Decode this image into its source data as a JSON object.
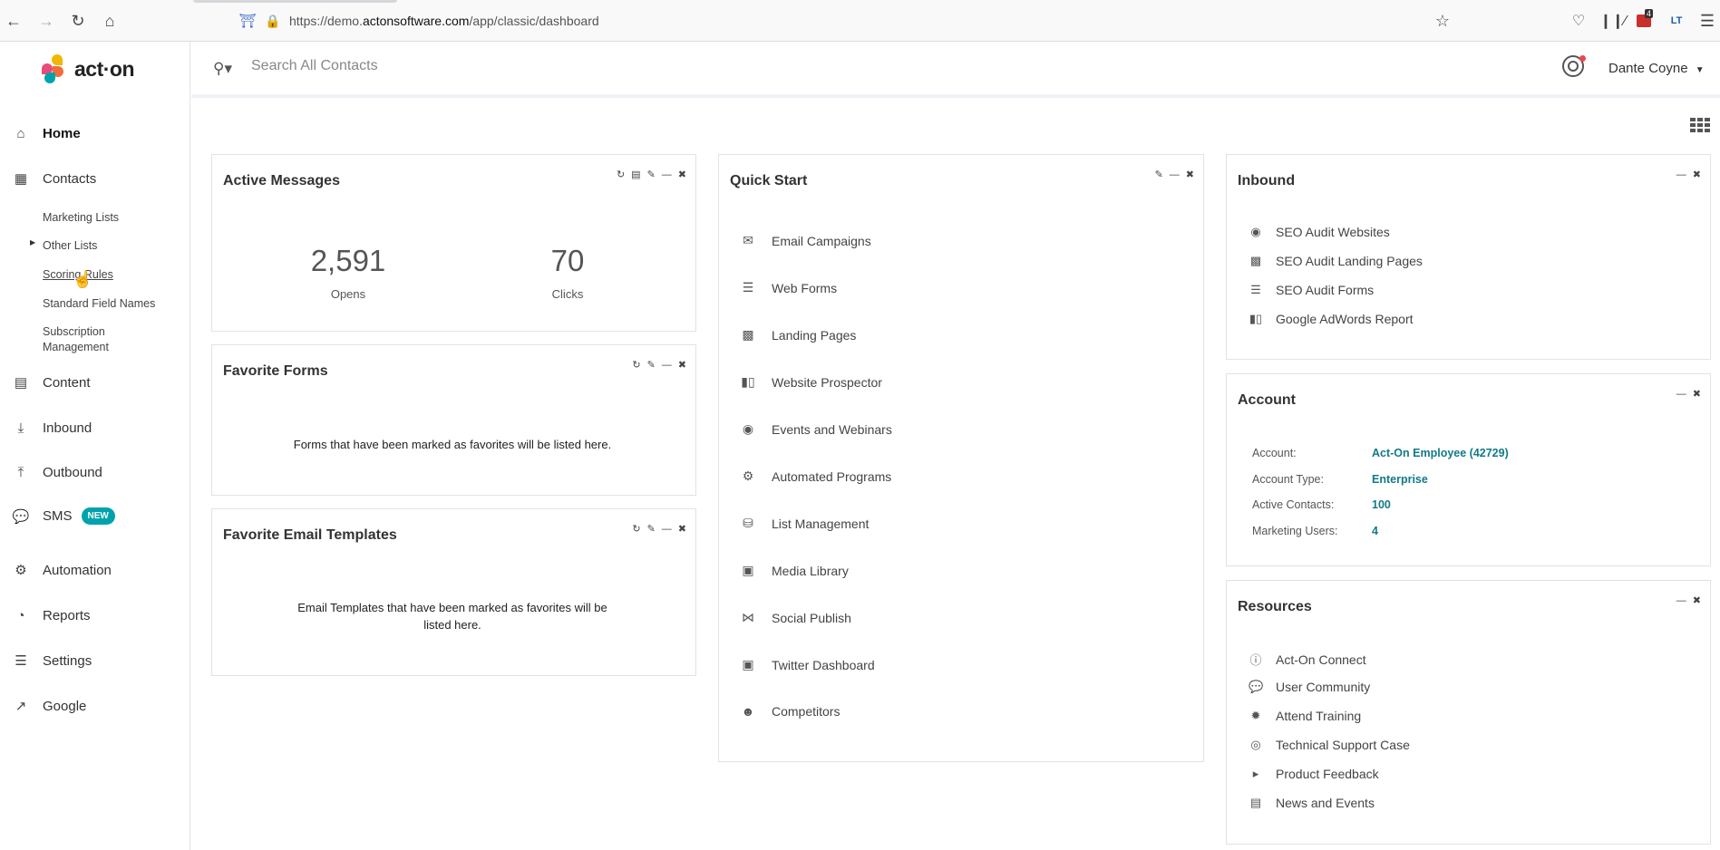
{
  "browser": {
    "url_prefix": "https://demo.",
    "url_host": "actonsoftware.com",
    "url_path": "/app/classic/dashboard",
    "toolbar_badge": "4"
  },
  "logo": {
    "text": "act·on"
  },
  "sidebar": {
    "items": [
      {
        "label": "Home",
        "icon": "home-icon"
      },
      {
        "label": "Contacts",
        "icon": "contacts-icon"
      },
      {
        "label": "Content",
        "icon": "content-icon"
      },
      {
        "label": "Inbound",
        "icon": "inbound-icon"
      },
      {
        "label": "Outbound",
        "icon": "outbound-icon"
      },
      {
        "label": "SMS",
        "icon": "sms-icon",
        "badge": "NEW"
      },
      {
        "label": "Automation",
        "icon": "automation-icon"
      },
      {
        "label": "Reports",
        "icon": "reports-icon"
      },
      {
        "label": "Settings",
        "icon": "settings-icon"
      },
      {
        "label": "Google",
        "icon": "external-link-icon"
      }
    ],
    "contacts_sub": [
      "Marketing Lists",
      "Other Lists",
      "Scoring Rules",
      "Standard Field Names",
      "Subscription",
      "Management"
    ]
  },
  "topbar": {
    "search_placeholder": "Search All Contacts",
    "user_name": "Dante Coyne"
  },
  "active_messages": {
    "title": "Active Messages",
    "opens_value": "2,591",
    "opens_label": "Opens",
    "clicks_value": "70",
    "clicks_label": "Clicks"
  },
  "favorite_forms": {
    "title": "Favorite Forms",
    "empty": "Forms that have been marked as favorites will be listed here."
  },
  "favorite_email_templates": {
    "title": "Favorite Email Templates",
    "empty_line1": "Email Templates that have been marked as favorites will be",
    "empty_line2": "listed here."
  },
  "quick_start": {
    "title": "Quick Start",
    "items": [
      {
        "label": "Email Campaigns",
        "icon": "envelope-icon"
      },
      {
        "label": "Web Forms",
        "icon": "list-icon"
      },
      {
        "label": "Landing Pages",
        "icon": "file-icon"
      },
      {
        "label": "Website Prospector",
        "icon": "bar-chart-icon"
      },
      {
        "label": "Events and Webinars",
        "icon": "globe-icon"
      },
      {
        "label": "Automated Programs",
        "icon": "gears-icon"
      },
      {
        "label": "List Management",
        "icon": "database-icon"
      },
      {
        "label": "Media Library",
        "icon": "image-icon"
      },
      {
        "label": "Social Publish",
        "icon": "share-icon"
      },
      {
        "label": "Twitter Dashboard",
        "icon": "twitter-icon"
      },
      {
        "label": "Competitors",
        "icon": "users-icon"
      }
    ]
  },
  "inbound": {
    "title": "Inbound",
    "items": [
      {
        "label": "SEO Audit Websites",
        "icon": "globe-icon"
      },
      {
        "label": "SEO Audit Landing Pages",
        "icon": "file-icon"
      },
      {
        "label": "SEO Audit Forms",
        "icon": "list-icon"
      },
      {
        "label": "Google AdWords Report",
        "icon": "bar-chart-icon"
      }
    ]
  },
  "account": {
    "title": "Account",
    "rows": [
      {
        "key": "Account:",
        "value": "Act-On Employee (42729)"
      },
      {
        "key": "Account Type:",
        "value": "Enterprise"
      },
      {
        "key": "Active Contacts:",
        "value": "100"
      },
      {
        "key": "Marketing Users:",
        "value": "4"
      }
    ]
  },
  "resources": {
    "title": "Resources",
    "items": [
      {
        "label": "Act-On Connect",
        "icon": "info-icon"
      },
      {
        "label": "User Community",
        "icon": "comments-icon"
      },
      {
        "label": "Attend Training",
        "icon": "certificate-icon"
      },
      {
        "label": "Technical Support Case",
        "icon": "life-ring-icon"
      },
      {
        "label": "Product Feedback",
        "icon": "bullhorn-icon"
      },
      {
        "label": "News and Events",
        "icon": "newspaper-icon"
      }
    ]
  },
  "colors": {
    "accent_teal": "#127a87",
    "badge_teal": "#00a3ad",
    "notify_red": "#e8474c"
  }
}
